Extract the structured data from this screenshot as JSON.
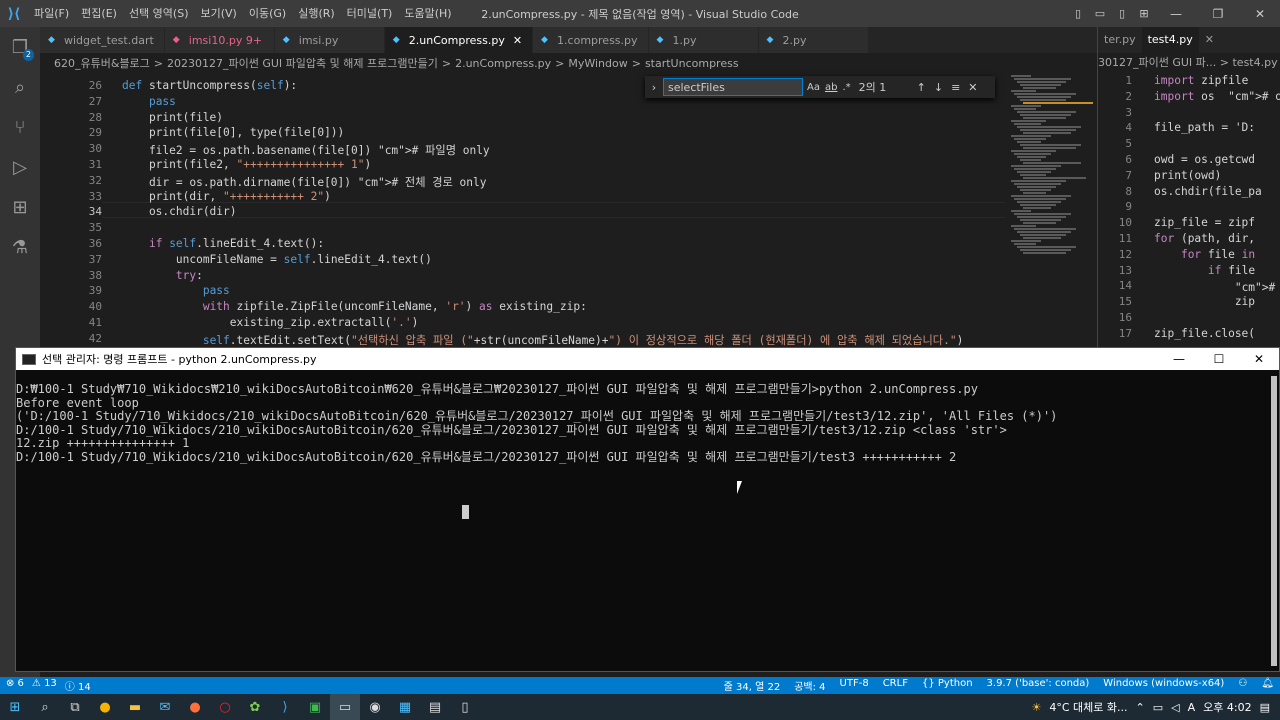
{
  "window": {
    "title": "2.unCompress.py - 제목 없음(작업 영역) - Visual Studio Code",
    "menu": [
      "파일(F)",
      "편집(E)",
      "선택 영역(S)",
      "보기(V)",
      "이동(G)",
      "실행(R)",
      "터미널(T)",
      "도움말(H)"
    ]
  },
  "activity": {
    "badge": "2"
  },
  "tabs": [
    {
      "label": "widget_test.dart",
      "icon": "◆",
      "color": "#4fc1ff"
    },
    {
      "label": "imsi10.py 9+",
      "icon": "◆",
      "color": "#e8638b"
    },
    {
      "label": "imsi.py",
      "icon": "◆",
      "color": "#4fc1ff"
    },
    {
      "label": "2.unCompress.py",
      "icon": "◆",
      "color": "#4fc1ff",
      "close": "✕"
    },
    {
      "label": "1.compress.py",
      "icon": "◆",
      "color": "#4fc1ff"
    },
    {
      "label": "1.py",
      "icon": "◆",
      "color": "#4fc1ff"
    },
    {
      "label": "2.py",
      "icon": "◆",
      "color": "#4fc1ff"
    }
  ],
  "breadcrumb": [
    "620_유튜버&블로그",
    ">",
    "20230127_파이썬 GUI 파일압축 및 해제 프로그램만들기",
    ">",
    "2.unCompress.py",
    ">",
    "MyWindow",
    ">",
    "startUncompress"
  ],
  "find": {
    "value": "selectFiles",
    "opt1": "Aa",
    "opt2": "ab",
    "opt3": ".*",
    "count": "2의 1",
    "up": "↑",
    "down": "↓",
    "list": "≡",
    "close": "✕",
    "toggle": "›"
  },
  "code_lines": [
    {
      "n": "26",
      "text": "def startUncompress(self):"
    },
    {
      "n": "27",
      "text": "    pass"
    },
    {
      "n": "28",
      "text": "    print(file)"
    },
    {
      "n": "29",
      "text": "    print(file[0], type(file[0]))"
    },
    {
      "n": "30",
      "text": "    file2 = os.path.basename(file[0]) # 파일명 only"
    },
    {
      "n": "31",
      "text": "    print(file2, \"+++++++++++++++ 1\")"
    },
    {
      "n": "32",
      "text": "    dir = os.path.dirname(file[0]) # 전체 경로 only"
    },
    {
      "n": "33",
      "text": "    print(dir, \"+++++++++++ 2\")"
    },
    {
      "n": "34",
      "text": "    os.chdir(dir)"
    },
    {
      "n": "35",
      "text": ""
    },
    {
      "n": "36",
      "text": "    if self.lineEdit_4.text():"
    },
    {
      "n": "37",
      "text": "        uncomFileName = self.lineEdit_4.text()"
    },
    {
      "n": "38",
      "text": "        try:"
    },
    {
      "n": "39",
      "text": "            pass"
    },
    {
      "n": "40",
      "text": "            with zipfile.ZipFile(uncomFileName, 'r') as existing_zip:"
    },
    {
      "n": "41",
      "text": "                existing_zip.extractall('.')"
    },
    {
      "n": "42",
      "text": "            self.textEdit.setText(\"선택하신 압축 파일 (\"+str(uncomFileName)+\") 이 정상적으로 해당 폴더 (현재폴더) 에 압축 해제 되었습니다.\")"
    }
  ],
  "right_pane": {
    "tabs": [
      "ter.py",
      "test4.py",
      "✕"
    ],
    "breadcrumb": "30127_파이썬 GUI 파...  >  test4.py",
    "lines": [
      {
        "n": "1",
        "text": "import zipfile"
      },
      {
        "n": "2",
        "text": "import os  # os"
      },
      {
        "n": "3",
        "text": ""
      },
      {
        "n": "4",
        "text": "file_path = 'D:"
      },
      {
        "n": "5",
        "text": ""
      },
      {
        "n": "6",
        "text": "owd = os.getcwd"
      },
      {
        "n": "7",
        "text": "print(owd)"
      },
      {
        "n": "8",
        "text": "os.chdir(file_pa"
      },
      {
        "n": "9",
        "text": ""
      },
      {
        "n": "10",
        "text": "zip_file = zipf"
      },
      {
        "n": "11",
        "text": "for (path, dir,"
      },
      {
        "n": "12",
        "text": "    for file in"
      },
      {
        "n": "13",
        "text": "        if file"
      },
      {
        "n": "14",
        "text": "            # 소"
      },
      {
        "n": "15",
        "text": "            zip"
      },
      {
        "n": "16",
        "text": ""
      },
      {
        "n": "17",
        "text": "zip_file.close("
      }
    ]
  },
  "cmd": {
    "title": "선택 관리자: 명령 프롬프트 - python  2.unCompress.py",
    "minimize": "—",
    "maximize": "☐",
    "close": "✕",
    "lines": [
      "D:₩100-1 Study₩710_Wikidocs₩210_wikiDocsAutoBitcoin₩620_유튜버&블로그₩20230127_파이썬 GUI 파일압축 및 해제 프로그램만들기>python 2.unCompress.py",
      "Before event loop",
      "('D:/100-1 Study/710_Wikidocs/210_wikiDocsAutoBitcoin/620_유튜버&블로그/20230127_파이썬 GUI 파일압축 및 해제 프로그램만들기/test3/12.zip', 'All Files (*)')",
      "D:/100-1 Study/710_Wikidocs/210_wikiDocsAutoBitcoin/620_유튜버&블로그/20230127_파이썬 GUI 파일압축 및 해제 프로그램만들기/test3/12.zip <class 'str'>",
      "12.zip +++++++++++++++ 1",
      "D:/100-1 Study/710_Wikidocs/210_wikiDocsAutoBitcoin/620_유튜버&블로그/20230127_파이썬 GUI 파일압축 및 해제 프로그램만들기/test3 +++++++++++ 2"
    ]
  },
  "status": {
    "errors": "⊗ 6",
    "warnings": "⚠ 13",
    "info": "ⓘ 14",
    "position": "줄 34, 열 22",
    "spaces": "공백: 4",
    "encoding": "UTF-8",
    "eol": "CRLF",
    "language": "{} Python",
    "interpreter": "3.9.7 ('base': conda)",
    "platform": "Windows (windows-x64)"
  },
  "taskbar": {
    "weather": "4°C  대체로 화...",
    "ime": "A",
    "time": "오후 4:02"
  }
}
